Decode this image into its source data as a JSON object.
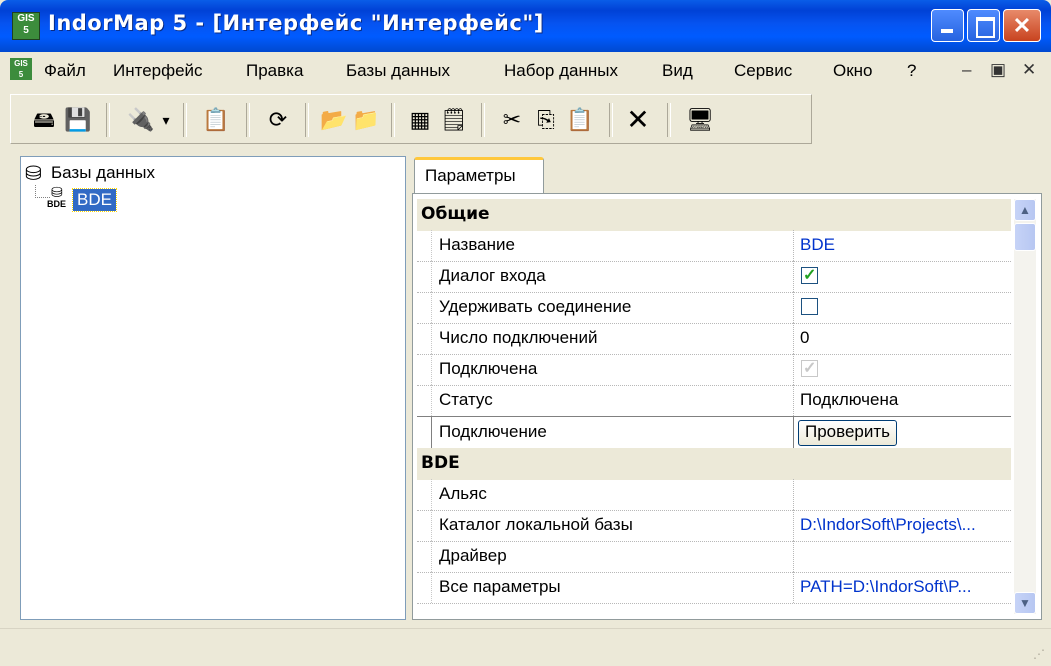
{
  "window": {
    "title": "IndorMap 5 - [Интерфейс \"Интерфейс\"]",
    "min_glyph": "_",
    "max_glyph": "□",
    "close_glyph": "✕"
  },
  "menu": {
    "items": [
      "Файл",
      "Интерфейс",
      "Правка",
      "Базы данных",
      "Набор данных",
      "Вид",
      "Сервис",
      "Окно",
      "?"
    ],
    "mdi_min": "–",
    "mdi_restore": "ᴥ",
    "mdi_close": "✕"
  },
  "toolbar": {
    "icons": [
      "new-db-icon",
      "save-icon",
      "connect-icon",
      "dropdown-arrow-icon",
      "properties-icon",
      "refresh-icon",
      "open-icon",
      "new-folder-icon",
      "table-icon",
      "sql-table-icon",
      "cut-icon",
      "copy-icon",
      "paste-icon",
      "delete-icon",
      "sql-icon"
    ]
  },
  "tree": {
    "root_label": "Базы данных",
    "child_label": "BDE",
    "child_icon_caption": "BDE"
  },
  "tab": {
    "label": "Параметры"
  },
  "properties": {
    "section_general": "Общие",
    "name_label": "Название",
    "name_value": "BDE",
    "login_dialog_label": "Диалог входа",
    "login_dialog_checked": true,
    "keep_connection_label": "Удерживать соединение",
    "keep_connection_checked": false,
    "connection_count_label": "Число подключений",
    "connection_count_value": "0",
    "connected_label": "Подключена",
    "connected_checked": true,
    "status_label": "Статус",
    "status_value": "Подключена",
    "connection_label": "Подключение",
    "check_button": "Проверить",
    "section_bde": "BDE",
    "alias_label": "Альяс",
    "alias_value": "",
    "local_catalog_label": "Каталог локальной базы",
    "local_catalog_value": "D:\\IndorSoft\\Projects\\...",
    "driver_label": "Драйвер",
    "driver_value": "",
    "all_params_label": "Все параметры",
    "all_params_value": "PATH=D:\\IndorSoft\\P..."
  },
  "colors": {
    "title_blue": "#0054e3",
    "value_blue": "#0033cc",
    "tab_accent": "#ffc83c",
    "check_green": "#21a121"
  }
}
